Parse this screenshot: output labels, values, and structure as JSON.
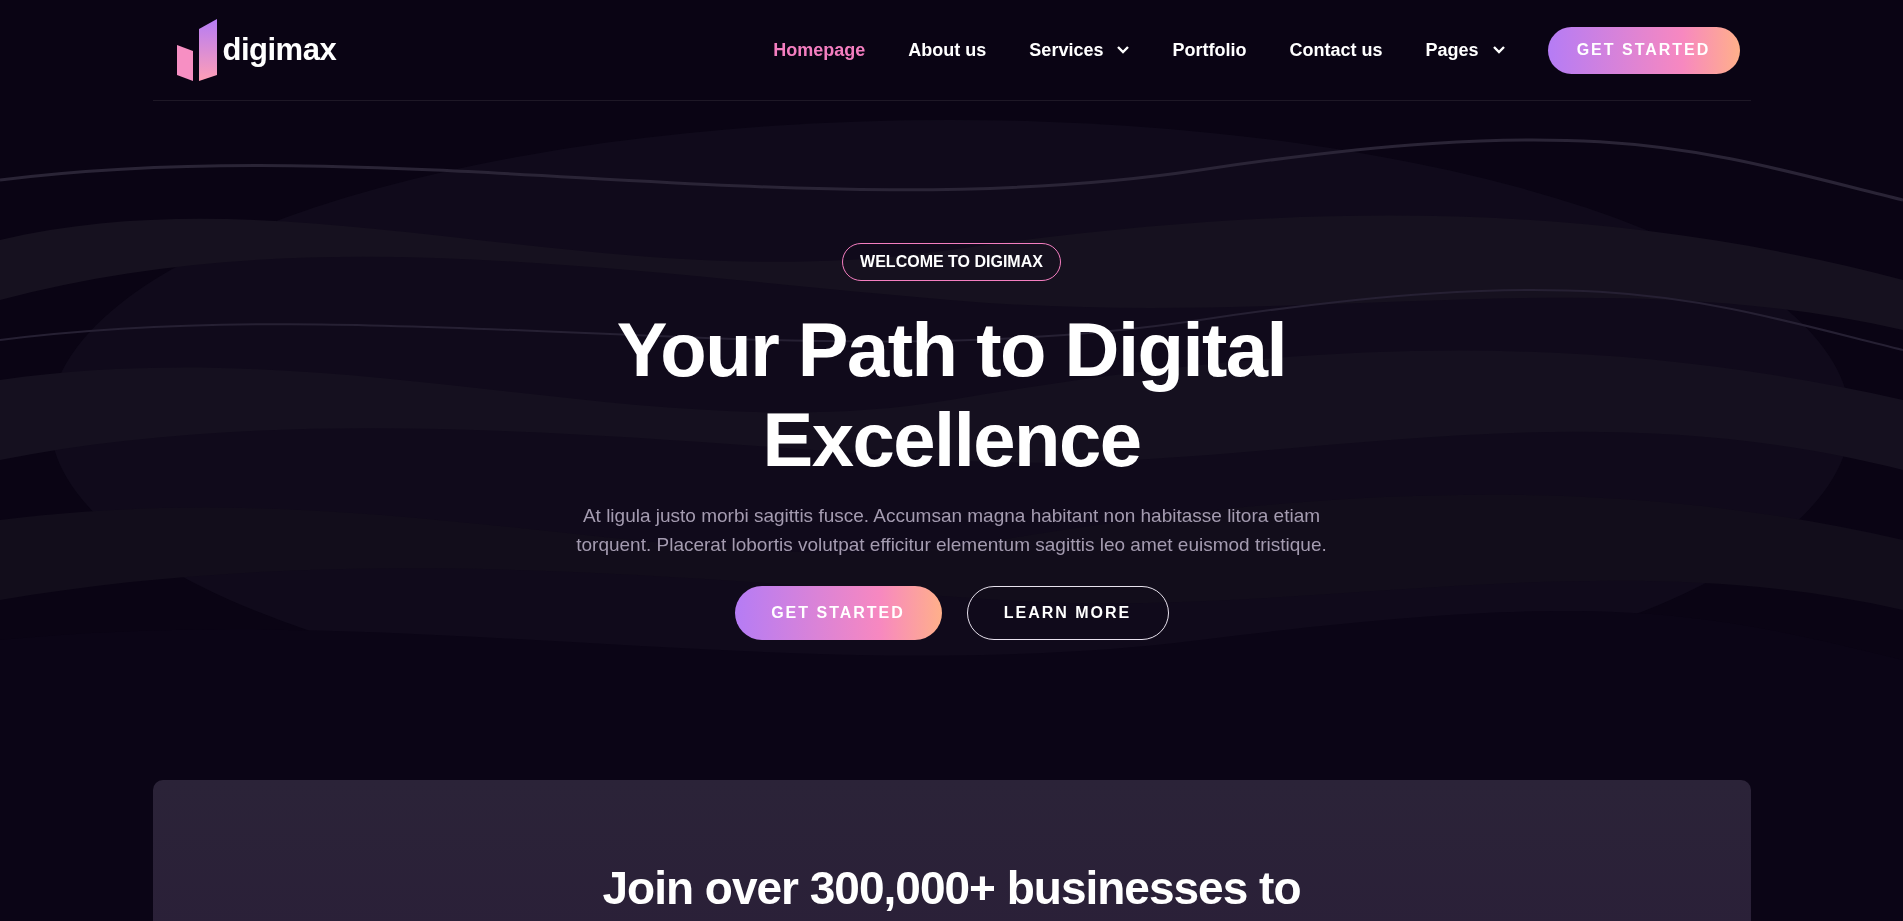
{
  "header": {
    "logo": "digimax",
    "nav": [
      {
        "label": "Homepage",
        "selected": true,
        "dropdown": false
      },
      {
        "label": "About us",
        "selected": false,
        "dropdown": false
      },
      {
        "label": "Services",
        "selected": false,
        "dropdown": true
      },
      {
        "label": "Portfolio",
        "selected": false,
        "dropdown": false
      },
      {
        "label": "Contact us",
        "selected": false,
        "dropdown": false
      },
      {
        "label": "Pages",
        "selected": false,
        "dropdown": true
      }
    ],
    "cta": "GET STARTED"
  },
  "hero": {
    "badge": "WELCOME TO DIGIMAX",
    "title_lines": [
      "Your Path to Digital",
      "Excellence"
    ],
    "text": "At ligula justo morbi sagittis fusce. Accumsan magna habitant non habitasse litora etiam torquent. Placerat lobortis volutpat efficitur elementum sagittis leo amet euismod tristique.",
    "buttons": [
      {
        "label": "GET STARTED",
        "kind": "primary"
      },
      {
        "label": "LEARN MORE",
        "kind": "outline"
      }
    ]
  },
  "card": {
    "heading": "Join over 300,000+ businesses to"
  }
}
